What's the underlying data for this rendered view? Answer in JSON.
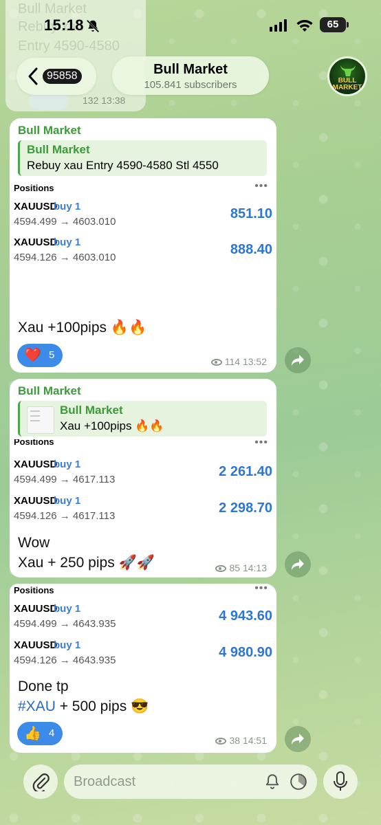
{
  "status_bar": {
    "time": "15:18",
    "battery": "65"
  },
  "header": {
    "back_count": "95858",
    "channel_title": "Bull Market",
    "subscribers": "105.841 subscribers",
    "avatar_text": "BULL MARKET"
  },
  "top_message": {
    "lines": [
      "Bull Market",
      "Rebuy xau",
      "Entry 4590-4580"
    ],
    "meta": "132 13:38"
  },
  "messages": [
    {
      "sender": "Bull Market",
      "quote_name": "Bull Market",
      "quote_text": "Rebuy xau Entry 4590-4580 Stl 4550",
      "positions_header": "Positions",
      "positions": [
        {
          "symbol": "XAUUSD",
          "side": "buy 1",
          "prices": "4594.499 → 4603.010",
          "profit": "851.10"
        },
        {
          "symbol": "XAUUSD",
          "side": "buy 1",
          "prices": "4594.126 → 4603.010",
          "profit": "888.40"
        }
      ],
      "text_line1": "Xau +100pips 🔥🔥",
      "reaction_emoji": "❤️",
      "reaction_count": "5",
      "views": "114",
      "time": "13:52"
    },
    {
      "sender": "Bull Market",
      "quote_name": "Bull Market",
      "quote_text": "Xau +100pips 🔥🔥",
      "positions_header": "Positions",
      "positions": [
        {
          "symbol": "XAUUSD",
          "side": "buy 1",
          "prices": "4594.499 → 4617.113",
          "profit": "2 261.40"
        },
        {
          "symbol": "XAUUSD",
          "side": "buy 1",
          "prices": "4594.126 → 4617.113",
          "profit": "2 298.70"
        }
      ],
      "text_line1": "Wow",
      "text_line2": "Xau + 250 pips 🚀🚀",
      "views": "85",
      "time": "14:13"
    },
    {
      "positions_header": "Positions",
      "positions": [
        {
          "symbol": "XAUUSD",
          "side": "buy 1",
          "prices": "4594.499 → 4643.935",
          "profit": "4 943.60"
        },
        {
          "symbol": "XAUUSD",
          "side": "buy 1",
          "prices": "4594.126 → 4643.935",
          "profit": "4 980.90"
        }
      ],
      "text_line1": "Done tp",
      "hashtag": "#XAU",
      "text_line2_rest": " + 500 pips 😎",
      "reaction_emoji": "👍",
      "reaction_count": "4",
      "views": "38",
      "time": "14:51"
    }
  ],
  "composer": {
    "placeholder": "Broadcast"
  },
  "icons": {
    "bell": "bell-muted-icon",
    "signal": "cellular-signal-icon",
    "wifi": "wifi-icon",
    "back": "chevron-left-icon",
    "share": "share-arrow-icon",
    "attach": "paperclip-icon",
    "silent": "bell-icon",
    "timer": "timer-icon",
    "mic": "microphone-icon"
  },
  "colors": {
    "accent": "#3c9a3a",
    "link": "#2f76d0",
    "reaction": "#3d8be8"
  }
}
